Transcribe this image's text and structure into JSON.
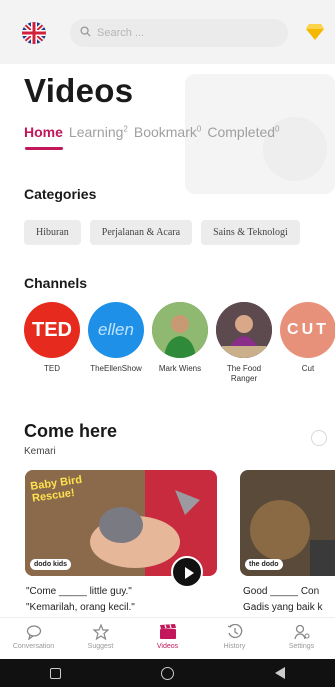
{
  "search": {
    "placeholder": "Search ..."
  },
  "page": {
    "title": "Videos"
  },
  "tabs": [
    {
      "label": "Home",
      "count": ""
    },
    {
      "label": "Learning",
      "count": "2"
    },
    {
      "label": "Bookmark",
      "count": "0"
    },
    {
      "label": "Completed",
      "count": "0"
    }
  ],
  "categories": {
    "heading": "Categories",
    "items": [
      "Hiburan",
      "Perjalanan & Acara",
      "Sains & Teknologi"
    ]
  },
  "channels": {
    "heading": "Channels",
    "items": [
      {
        "name": "TED",
        "logo_text": "TED",
        "color": "#e62b1e"
      },
      {
        "name": "TheEllenShow",
        "logo_text": "ellen",
        "color": "#1e90e8"
      },
      {
        "name": "Mark Wiens",
        "logo_text": "",
        "color": "#5a7a3a"
      },
      {
        "name": "The Food Ranger",
        "logo_text": "",
        "color": "#6a4a6a"
      },
      {
        "name": "Cut",
        "logo_text": "CUT",
        "color": "#e8917a"
      }
    ]
  },
  "come_here": {
    "title": "Come here",
    "subtitle": "Kemari"
  },
  "videos": [
    {
      "badge": "dodo kids",
      "overlay_text": "Baby Bird Rescue!",
      "line1": "\"Come _____ little guy.\"",
      "line2": "\"Kemarilah, orang kecil.\""
    },
    {
      "badge": "the dodo",
      "line1": "Good _____ Con",
      "line2": "Gadis yang baik k"
    }
  ],
  "nav": [
    {
      "label": "Conversation",
      "icon": "chat-icon"
    },
    {
      "label": "Suggest",
      "icon": "star-icon"
    },
    {
      "label": "Videos",
      "icon": "clapperboard-icon",
      "active": true
    },
    {
      "label": "History",
      "icon": "history-icon"
    },
    {
      "label": "Settings",
      "icon": "settings-icon"
    }
  ],
  "colors": {
    "accent": "#c2185b",
    "gem": "#f5b800"
  }
}
